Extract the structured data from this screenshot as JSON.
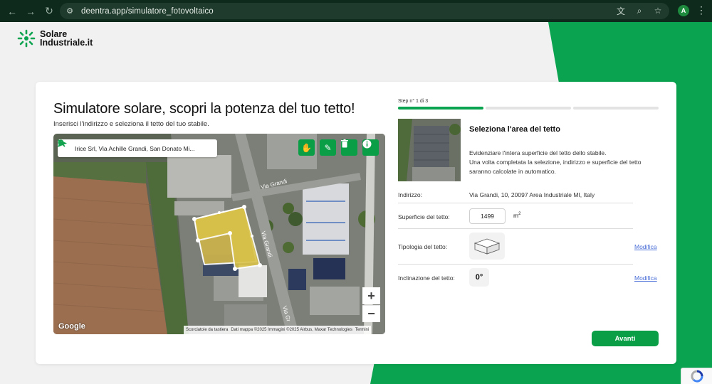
{
  "browser": {
    "url": "deentra.app/simulatore_fotovoltaico",
    "profile_initial": "A"
  },
  "logo": {
    "line1": "Solare",
    "line2": "Industriale.it"
  },
  "card": {
    "title": "Simulatore solare, scopri la potenza del tuo tetto!",
    "subtitle": "Inserisci l'indirizzo e seleziona il tetto del tuo stabile."
  },
  "map": {
    "search_value": "Irice Srl, Via Achille Grandi, San Donato Mi...",
    "road_labels": [
      "Via Grandi",
      "Via Grandi",
      "Via Gr"
    ],
    "zoom_in": "+",
    "zoom_out": "−",
    "google_label": "Google",
    "attribution": [
      "Scorciatoie da tastiera",
      "Dati mappa ©2025 Immagini ©2025 Airbus, Maxar Technologies",
      "Termini"
    ]
  },
  "step": {
    "label": "Step n° 1 di 3",
    "current": 1,
    "total": 3,
    "title": "Seleziona l'area del tetto",
    "desc1": "Evidenziare l'intera superficie del tetto dello stabile.",
    "desc2": "Una volta completata la selezione, indirizzo e superficie del tetto saranno calcolate in automatico."
  },
  "fields": {
    "address_label": "Indirizzo:",
    "address_value": "Via Grandi, 10, 20097 Area Industriale MI, Italy",
    "surface_label": "Superficie del tetto:",
    "surface_value": "1499",
    "surface_unit": "m",
    "surface_unit_sup": "2",
    "type_label": "Tipologia del tetto:",
    "incl_label": "Inclinazione del tetto:",
    "incl_value": "0°",
    "edit_label": "Modifica"
  },
  "actions": {
    "next": "Avanti"
  },
  "colors": {
    "brand_green": "#0aa34f",
    "progress_inactive": "#e3e3e3",
    "link_blue": "#4b6fd8"
  }
}
